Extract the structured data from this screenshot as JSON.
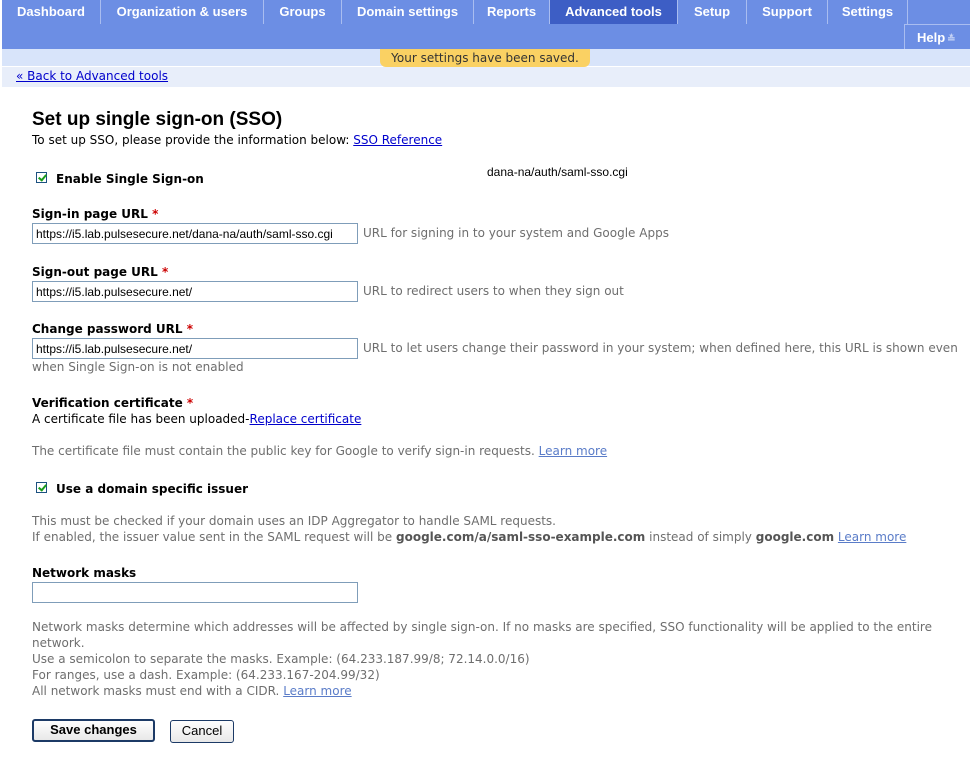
{
  "nav": {
    "tabs": [
      {
        "label": "Dashboard"
      },
      {
        "label": "Organization & users"
      },
      {
        "label": "Groups"
      },
      {
        "label": "Domain settings"
      },
      {
        "label": "Reports"
      },
      {
        "label": "Advanced tools"
      },
      {
        "label": "Setup"
      },
      {
        "label": "Support"
      },
      {
        "label": "Settings"
      }
    ],
    "active_tab": "Advanced tools",
    "help_label": "Help",
    "help_icon": "double-chevron-down-icon"
  },
  "notice": "Your settings have been saved.",
  "back_link": "« Back to Advanced tools",
  "page": {
    "title": "Set up single sign-on (SSO)",
    "intro": "To set up SSO, please provide the information below:",
    "intro_link": "SSO Reference",
    "stray_text": "dana-na/auth/saml-sso.cgi"
  },
  "enable_sso": {
    "label": "Enable Single Sign-on",
    "checked": true
  },
  "signin": {
    "label": "Sign-in page URL",
    "required": "*",
    "value": "https://i5.lab.pulsesecure.net/dana-na/auth/saml-sso.cgi",
    "hint": "URL for signing in to your system and Google Apps"
  },
  "signout": {
    "label": "Sign-out page URL",
    "required": "*",
    "value": "https://i5.lab.pulsesecure.net/",
    "hint": "URL to redirect users to when they sign out"
  },
  "change_password": {
    "label": "Change password URL",
    "required": "*",
    "value": "https://i5.lab.pulsesecure.net/",
    "hint_line1": "URL to let users change their password in your system; when defined here, this URL is shown even",
    "hint_line2": "when Single Sign-on is not enabled"
  },
  "certificate": {
    "label": "Verification certificate",
    "required": "*",
    "status": "A certificate file has been uploaded-",
    "replace_link": "Replace certificate",
    "hint": "The certificate file must contain the public key for Google to verify sign-in requests.",
    "learn_more": "Learn more"
  },
  "issuer": {
    "label": "Use a domain specific issuer",
    "checked": true,
    "hint_line1": "This must be checked if your domain uses an IDP Aggregator to handle SAML requests.",
    "hint_line2_a": "If enabled, the issuer value sent in the SAML request will be",
    "hint_line2_bold1": "google.com/a/saml-sso-example.com",
    "hint_line2_b": "instead of simply",
    "hint_line2_bold2": "google.com",
    "learn_more": "Learn more"
  },
  "network_masks": {
    "label": "Network masks",
    "value": "",
    "hint_line1": "Network masks determine which addresses will be affected by single sign-on. If no masks are specified, SSO functionality will be applied to the entire",
    "hint_line2": "network.",
    "hint_line3": "Use a semicolon to separate the masks. Example: (64.233.187.99/8; 72.14.0.0/16)",
    "hint_line4": "For ranges, use a dash. Example: (64.233.167-204.99/32)",
    "hint_line5": "All network masks must end with a CIDR.",
    "learn_more": "Learn more"
  },
  "buttons": {
    "save": "Save changes",
    "cancel": "Cancel"
  }
}
